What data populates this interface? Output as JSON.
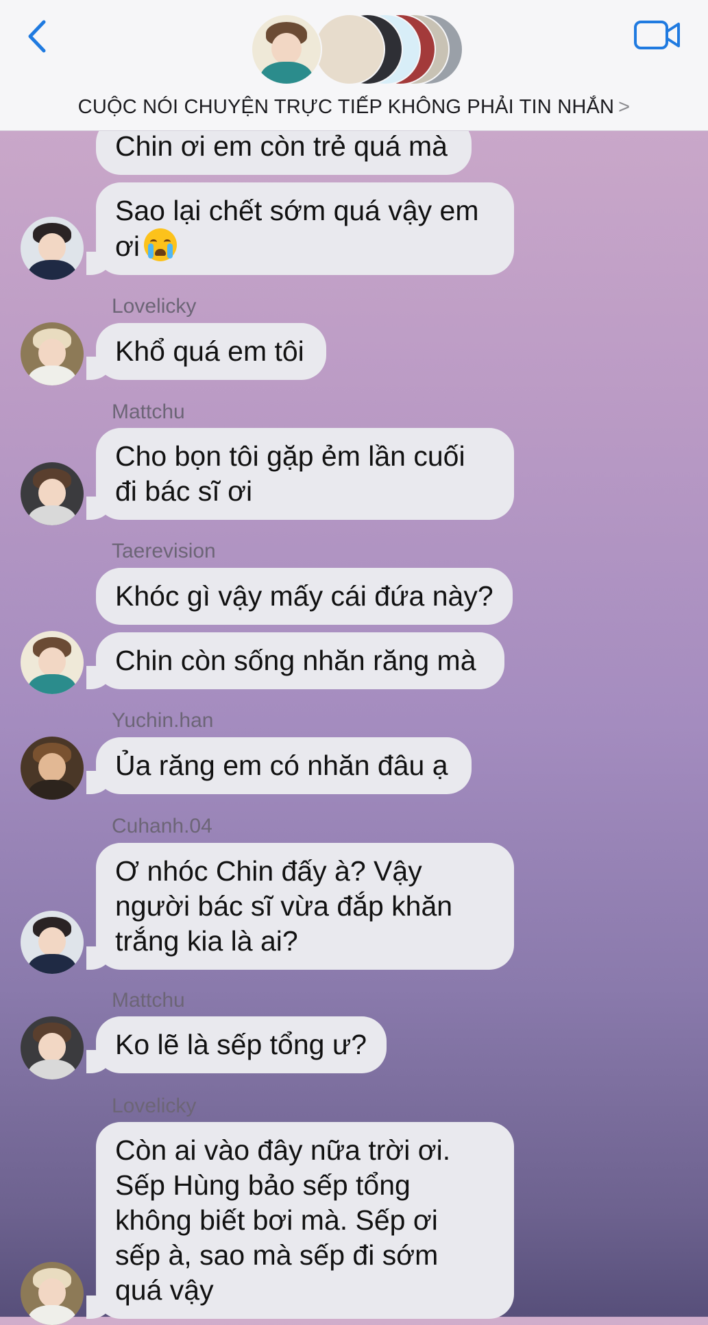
{
  "header": {
    "title": "CUỘC NÓI CHUYỆN TRỰC TIẾP KHÔNG PHẢI TIN NHẮN",
    "title_chevron": ">",
    "back_icon": "chevron-left-icon",
    "video_icon": "video-camera-icon",
    "accent": "#1f7ae0"
  },
  "messages": [
    {
      "sender": "",
      "text": "Chin ơi em còn trẻ quá mà"
    },
    {
      "sender": "",
      "text_lines": [
        "Sao lại chết sớm quá vậy em",
        "ơi"
      ],
      "emoji": "loudly-crying-face"
    },
    {
      "sender": "Lovelicky",
      "text": "Khổ quá em tôi"
    },
    {
      "sender": "Mattchu",
      "text_lines": [
        "Cho bọn tôi gặp ẻm lần cuối",
        "đi bác sĩ ơi"
      ]
    },
    {
      "sender": "Taerevision",
      "text": "Khóc gì vậy mấy cái đứa này?"
    },
    {
      "sender": "",
      "text": "Chin còn sống nhăn răng mà"
    },
    {
      "sender": "Yuchin.han",
      "text": "Ủa răng em có nhăn đâu ạ"
    },
    {
      "sender": "Cuhanh.04",
      "text_lines": [
        "Ơ nhóc Chin đấy à? Vậy",
        "người bác sĩ vừa đắp khăn",
        "trắng kia là ai?"
      ]
    },
    {
      "sender": "Mattchu",
      "text": "Ko lẽ là sếp tổng ư?"
    },
    {
      "sender": "Lovelicky",
      "text_lines": [
        "Còn ai vào đây nữa trời ơi.",
        "Sếp Hùng bảo sếp tổng",
        "không biết bơi mà. Sếp ơi",
        "sếp à, sao mà sếp đi sớm",
        "quá vậy"
      ]
    }
  ],
  "colors": {
    "bubble": "#e9e9ee",
    "header_bg": "#f6f6f8",
    "background_top": "#d0adcb",
    "background_bottom": "#574f7a"
  }
}
